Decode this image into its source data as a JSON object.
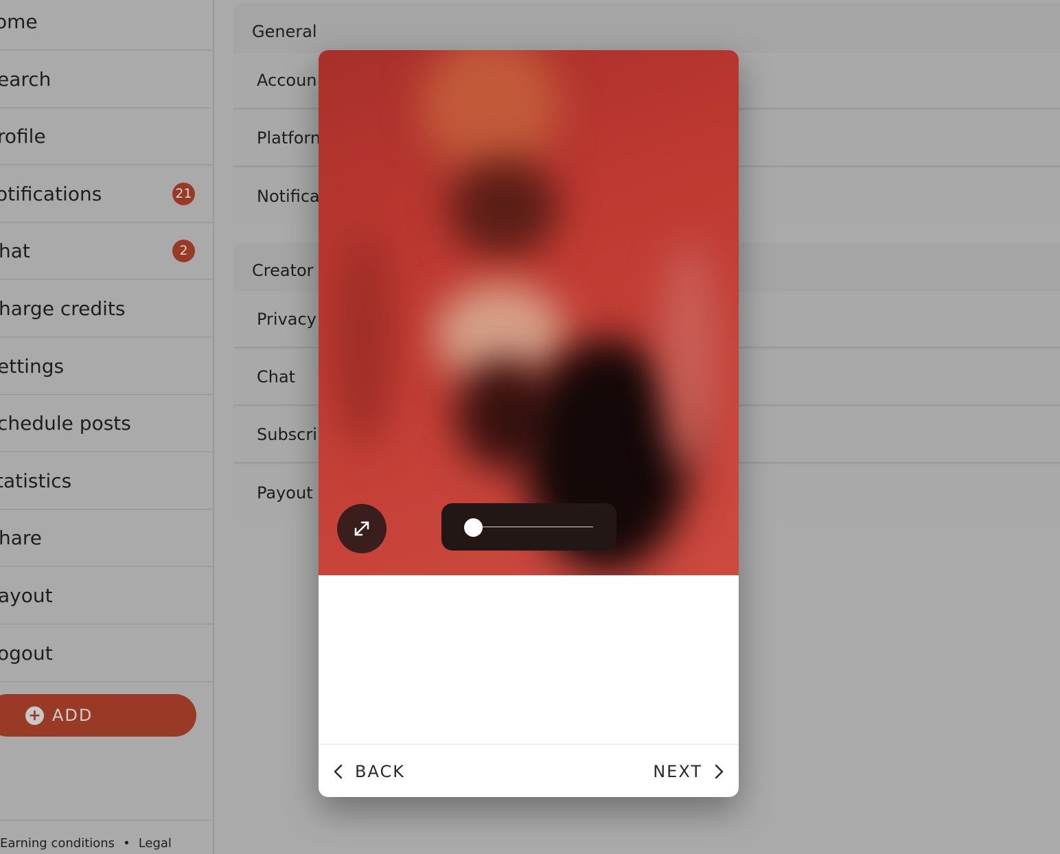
{
  "sidebar": {
    "items": [
      {
        "label": "ome",
        "badge": null
      },
      {
        "label": "earch",
        "badge": null
      },
      {
        "label": "rofile",
        "badge": null
      },
      {
        "label": "otifications",
        "badge": "21"
      },
      {
        "label": "hat",
        "badge": "2"
      },
      {
        "label": "harge credits",
        "badge": null
      },
      {
        "label": "ettings",
        "badge": null
      },
      {
        "label": "chedule posts",
        "badge": null
      },
      {
        "label": "tatistics",
        "badge": null
      },
      {
        "label": "hare",
        "badge": null
      },
      {
        "label": "ayout",
        "badge": null
      },
      {
        "label": "ogout",
        "badge": null
      }
    ],
    "add_label": "ADD",
    "footer": {
      "earning": "Earning conditions",
      "separator": "•",
      "legal": "Legal"
    }
  },
  "settings": {
    "general": {
      "title": "General",
      "rows": [
        "Accoun",
        "Platforn",
        "Notifica"
      ]
    },
    "creator": {
      "title": "Creator",
      "rows": [
        "Privacy",
        "Chat",
        "Subscri",
        "Payout"
      ]
    }
  },
  "modal": {
    "slider_value": 0,
    "back_label": "BACK",
    "next_label": "NEXT"
  },
  "colors": {
    "accent": "#983a26",
    "backdrop": "#aaaaaa",
    "media_red": "#c03a32"
  }
}
